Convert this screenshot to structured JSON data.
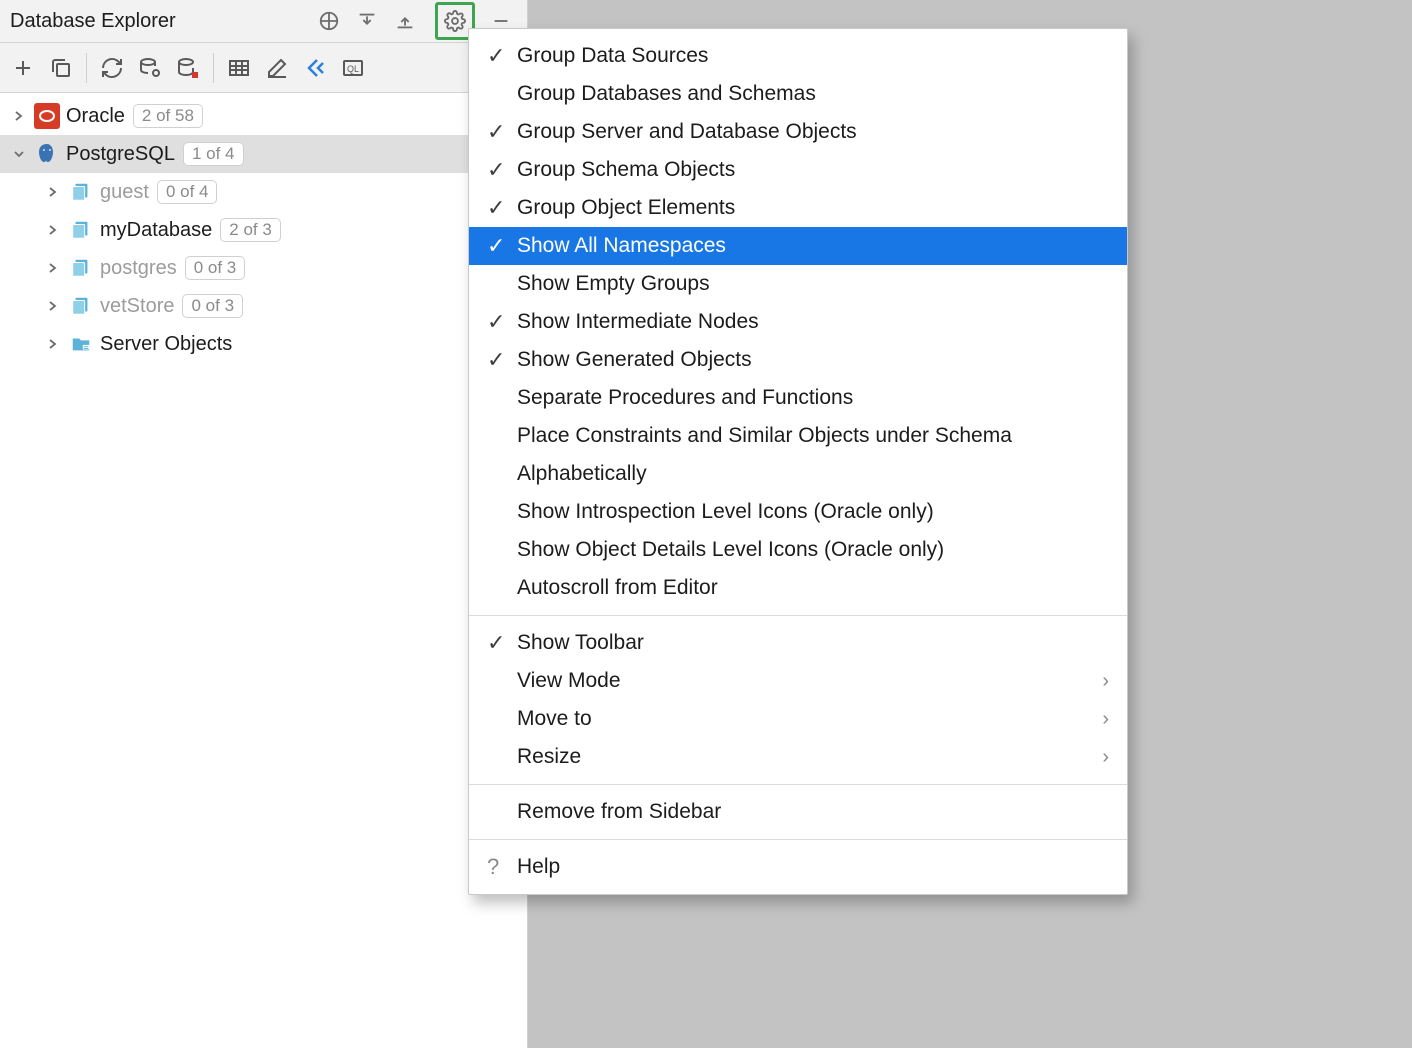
{
  "panel": {
    "title": "Database Explorer"
  },
  "tree": {
    "oracle": {
      "label": "Oracle",
      "badge": "2 of 58"
    },
    "postgres": {
      "label": "PostgreSQL",
      "badge": "1 of 4"
    },
    "children": [
      {
        "label": "guest",
        "badge": "0 of 4",
        "dim": true
      },
      {
        "label": "myDatabase",
        "badge": "2 of 3",
        "dim": false
      },
      {
        "label": "postgres",
        "badge": "0 of 3",
        "dim": true
      },
      {
        "label": "vetStore",
        "badge": "0 of 3",
        "dim": true
      }
    ],
    "server_objects": "Server Objects"
  },
  "menu": {
    "sections": [
      [
        {
          "label": "Group Data Sources",
          "checked": true
        },
        {
          "label": "Group Databases and Schemas",
          "checked": false
        },
        {
          "label": "Group Server and Database Objects",
          "checked": true
        },
        {
          "label": "Group Schema Objects",
          "checked": true
        },
        {
          "label": "Group Object Elements",
          "checked": true
        },
        {
          "label": "Show All Namespaces",
          "checked": true,
          "highlight": true
        },
        {
          "label": "Show Empty Groups",
          "checked": false
        },
        {
          "label": "Show Intermediate Nodes",
          "checked": true
        },
        {
          "label": "Show Generated Objects",
          "checked": true
        },
        {
          "label": "Separate Procedures and Functions",
          "checked": false
        },
        {
          "label": "Place Constraints and Similar Objects under Schema",
          "checked": false
        },
        {
          "label": "Alphabetically",
          "checked": false
        },
        {
          "label": "Show Introspection Level Icons (Oracle only)",
          "checked": false
        },
        {
          "label": "Show Object Details Level Icons (Oracle only)",
          "checked": false
        },
        {
          "label": "Autoscroll from Editor",
          "checked": false
        }
      ],
      [
        {
          "label": "Show Toolbar",
          "checked": true
        },
        {
          "label": "View Mode",
          "submenu": true
        },
        {
          "label": "Move to",
          "submenu": true
        },
        {
          "label": "Resize",
          "submenu": true
        }
      ],
      [
        {
          "label": "Remove from Sidebar"
        }
      ],
      [
        {
          "label": "Help",
          "help": true
        }
      ]
    ]
  }
}
